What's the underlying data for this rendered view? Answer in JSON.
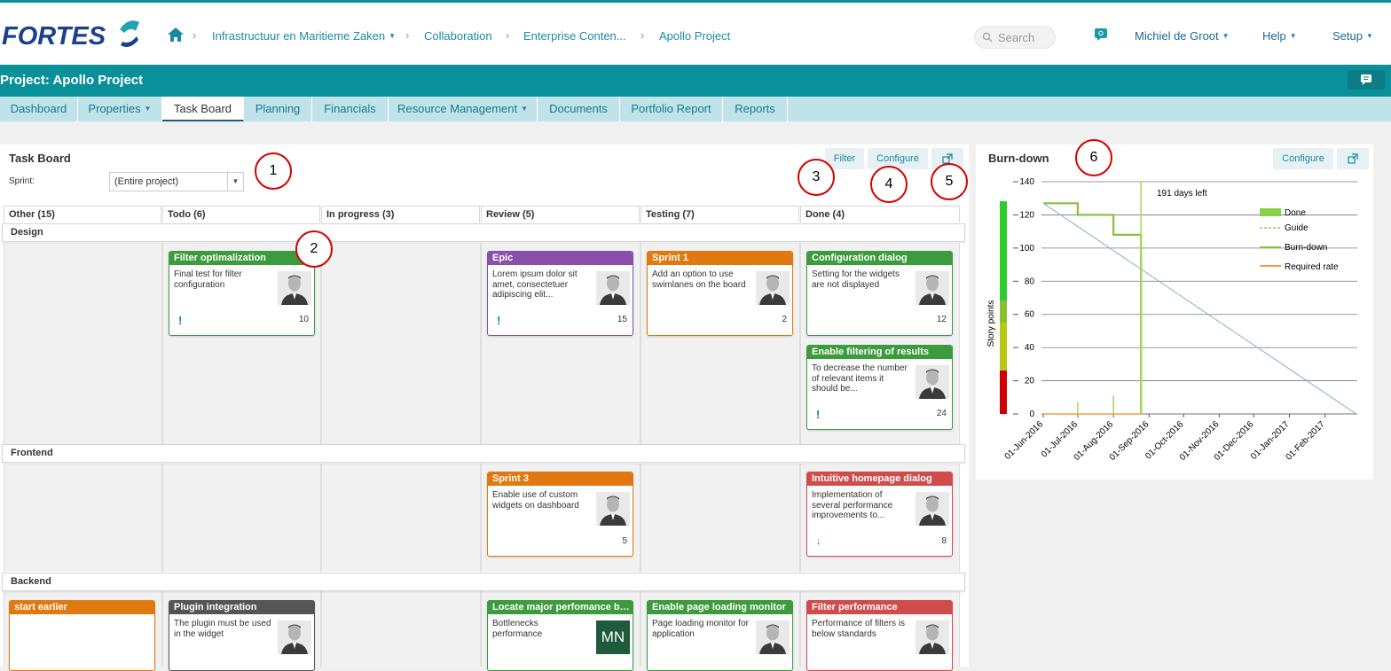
{
  "header": {
    "logo_text": "FORTES",
    "breadcrumbs": [
      "Infrastructuur en Maritieme Zaken",
      "Collaboration",
      "Enterprise Conten...",
      "Apollo Project"
    ],
    "search_placeholder": "Search",
    "user": "Michiel de Groot",
    "help": "Help",
    "setup": "Setup"
  },
  "project": {
    "title": "Project: Apollo Project"
  },
  "tabs": [
    "Dashboard",
    "Properties",
    "Task Board",
    "Planning",
    "Financials",
    "Resource Management",
    "Documents",
    "Portfolio Report",
    "Reports"
  ],
  "taskboard": {
    "title": "Task Board",
    "sprint_label": "Sprint:",
    "sprint_value": "(Entire project)",
    "filter": "Filter",
    "configure": "Configure",
    "columns": [
      "Other (15)",
      "Todo (6)",
      "In progress (3)",
      "Review (5)",
      "Testing (7)",
      "Done (4)"
    ],
    "swimlanes": [
      "Design",
      "Frontend",
      "Backend"
    ],
    "cards": [
      {
        "title": "Filter optimalization",
        "desc": "Final test for filter configuration",
        "points": "10",
        "priority": "!"
      },
      {
        "title": "Epic",
        "desc": "Lorem ipsum dolor sit amet, consectetuer adipiscing elit...",
        "points": "15",
        "priority": "!"
      },
      {
        "title": "Sprint 1",
        "desc": "Add an option to use swimlanes on the board",
        "points": "2"
      },
      {
        "title": "Configuration dialog",
        "desc": "Setting for the widgets are not displayed",
        "points": "12"
      },
      {
        "title": "Enable filtering of results",
        "desc": "To decrease the number of relevant items it should be...",
        "points": "24",
        "priority": "!"
      },
      {
        "title": "Sprint 3",
        "desc": "Enable use of custom widgets on dashboard",
        "points": "5"
      },
      {
        "title": "Intuitive homepage dialog",
        "desc": "Implementation of several performance improvements to...",
        "points": "8",
        "priority": "↓"
      },
      {
        "title": "start earlier",
        "desc": ""
      },
      {
        "title": "Plugin integration",
        "desc": "The plugin must be used in the widget"
      },
      {
        "title": "Locate major perfomance bot...",
        "desc": "Bottlenecks performance",
        "initials": "MN"
      },
      {
        "title": "Enable page loading monitor",
        "desc": "Page loading monitor for application"
      },
      {
        "title": "Filter performance",
        "desc": "Performance of filters is below standards"
      }
    ]
  },
  "burndown": {
    "title": "Burn-down",
    "configure": "Configure",
    "annotation": "191 days left",
    "legend": [
      "Done",
      "Guide",
      "Burn-down",
      "Required rate"
    ],
    "ylabel": "Story points",
    "yticks": [
      "0",
      "20",
      "40",
      "60",
      "80",
      "100",
      "120",
      "140"
    ],
    "xticks": [
      "01-Jun-2016",
      "01-Jul-2016",
      "01-Aug-2016",
      "01-Sep-2016",
      "01-Oct-2016",
      "01-Nov-2016",
      "01-Dec-2016",
      "01-Jan-2017",
      "01-Feb-2017"
    ]
  },
  "callouts": [
    "1",
    "2",
    "3",
    "4",
    "5",
    "6"
  ],
  "chart_data": {
    "type": "line",
    "title": "Burn-down",
    "ylabel": "Story points",
    "ylim": [
      0,
      140
    ],
    "x": [
      "01-Jun-2016",
      "01-Jul-2016",
      "01-Aug-2016",
      "01-Sep-2016",
      "01-Oct-2016",
      "01-Nov-2016",
      "01-Dec-2016",
      "01-Jan-2017",
      "01-Feb-2017"
    ],
    "series": [
      {
        "name": "Burn-down",
        "points": [
          [
            "01-Jun-2016",
            127
          ],
          [
            "01-Jul-2016",
            127
          ],
          [
            "01-Jul-2016",
            120
          ],
          [
            "01-Aug-2016",
            120
          ],
          [
            "01-Aug-2016",
            108
          ],
          [
            "25-Aug-2016",
            108
          ],
          [
            "25-Aug-2016",
            0
          ]
        ]
      },
      {
        "name": "Guide",
        "points": [
          [
            "01-Jun-2016",
            127
          ],
          [
            "28-Feb-2017",
            0
          ]
        ]
      },
      {
        "name": "Required rate",
        "points": [
          [
            "01-Jun-2016",
            0
          ],
          [
            "25-Aug-2016",
            0
          ]
        ]
      },
      {
        "name": "Done",
        "points": [
          [
            "01-Jul-2016",
            7
          ],
          [
            "01-Aug-2016",
            11
          ],
          [
            "25-Aug-2016",
            140
          ]
        ]
      }
    ],
    "legend": "top-right",
    "grid": true
  },
  "colors": {
    "teal": "#0a9099",
    "tab_bg": "#bfe3e8",
    "link": "#1a8aa0"
  }
}
